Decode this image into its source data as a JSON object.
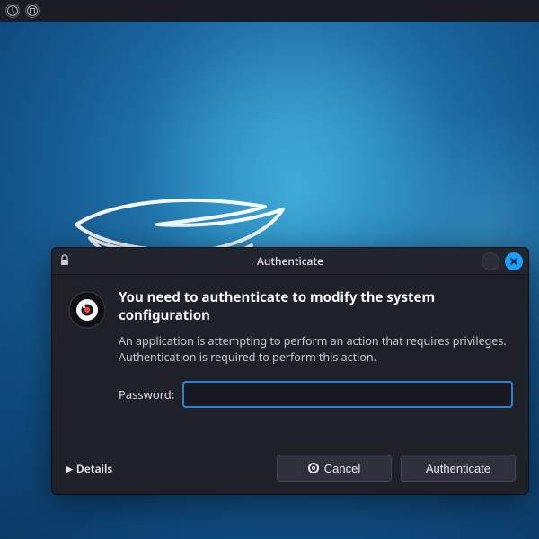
{
  "dialog": {
    "title": "Authenticate",
    "heading": "You need to authenticate to modify the system configuration",
    "message": "An application is attempting to perform an action that requires privileges. Authentication is required to perform this action.",
    "password_label": "Password:",
    "password_value": "",
    "details_label": "Details",
    "cancel_label": "Cancel",
    "authenticate_label": "Authenticate"
  },
  "colors": {
    "accent": "#1a9fff",
    "input_border": "#2f7fd6",
    "dialog_bg": "#1f2129",
    "panel_bg": "#1b1d24"
  }
}
